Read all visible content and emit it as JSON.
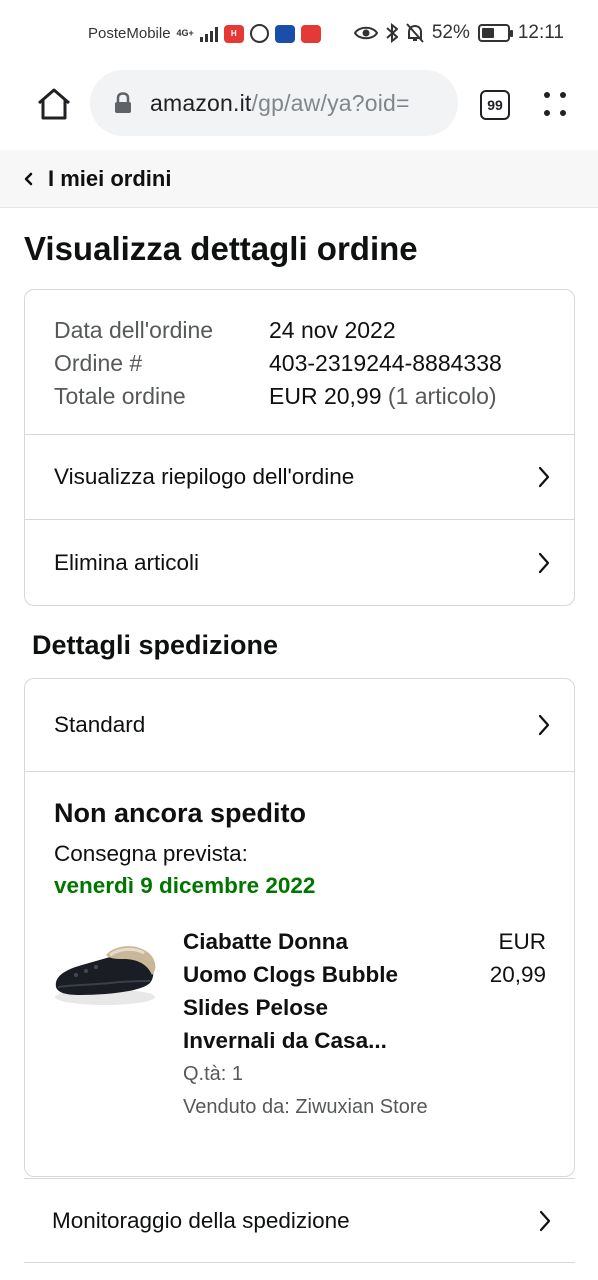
{
  "status_bar": {
    "carrier": "PosteMobile",
    "network": "4G+",
    "battery": "52%",
    "battery_level": 0.52,
    "time": "12:11",
    "icons": [
      "signal-icon",
      "huawei-app-icon",
      "whatsapp-icon",
      "app-icon",
      "aliexpress-icon",
      "eye-icon",
      "bluetooth-icon",
      "mute-icon",
      "battery-icon"
    ]
  },
  "browser": {
    "url_host": "amazon.it",
    "url_path": "/gp/aw/ya?oid=",
    "tab_count": "99"
  },
  "breadcrumb": {
    "label": "I miei ordini"
  },
  "page": {
    "title": "Visualizza dettagli ordine"
  },
  "order": {
    "date_label": "Data dell'ordine",
    "date_value": "24 nov 2022",
    "number_label": "Ordine #",
    "number_value": "403-2319244-8884338",
    "total_label": "Totale ordine",
    "total_value": "EUR 20,99",
    "total_items": "(1 articolo)"
  },
  "actions": {
    "view_summary": "Visualizza riepilogo dell'ordine",
    "remove_items": "Elimina articoli"
  },
  "shipping": {
    "section_title": "Dettagli spedizione",
    "method": "Standard",
    "status": "Non ancora spedito",
    "delivery_label": "Consegna prevista:",
    "delivery_date": "venerdì 9 dicembre 2022",
    "tracking": "Monitoraggio della spedizione"
  },
  "item": {
    "title_lines": [
      "Ciabatte Donna",
      "Uomo Clogs Bubble",
      "Slides Pelose",
      "Invernali da Casa..."
    ],
    "qty": "Q.tà: 1",
    "seller": "Venduto da: Ziwuxian Store",
    "price_currency": "EUR",
    "price_value": "20,99"
  },
  "colors": {
    "delivery_green": "#007600",
    "text": "#0f1111",
    "muted": "#565959",
    "border": "#d5d9d9"
  }
}
